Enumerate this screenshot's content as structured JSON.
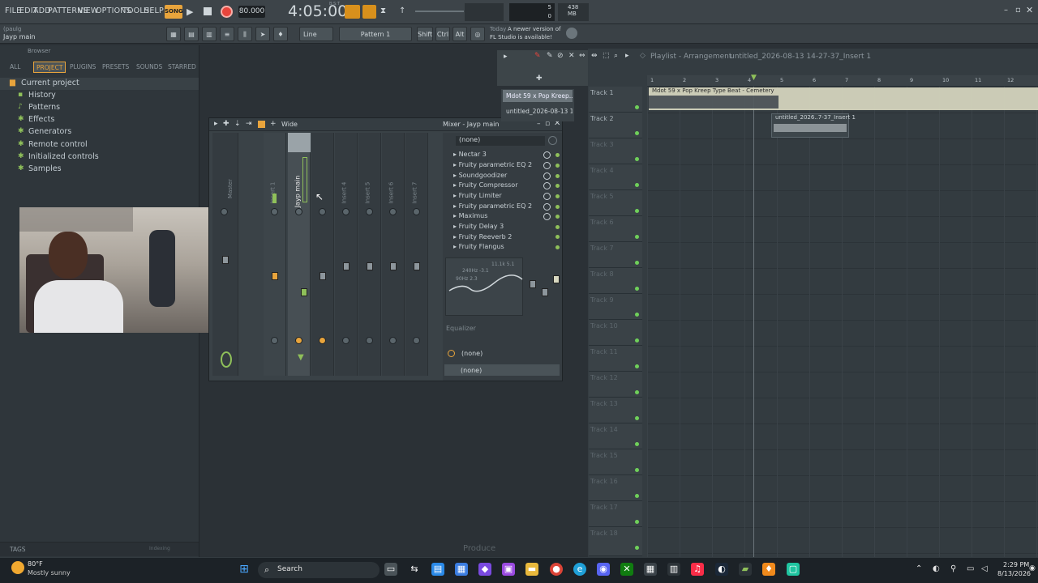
{
  "menu": [
    "FILE",
    "EDIT",
    "ADD",
    "PATTERNS",
    "VIEW",
    "OPTIONS",
    "TOOLS",
    "HELP"
  ],
  "transport": {
    "mode": "SONG",
    "tempo": "80.000",
    "time": "4:05:00",
    "time_sub": "B:S:T",
    "cpu": "5",
    "ram": "438 MB",
    "voices": "0"
  },
  "toolbar2": {
    "hint_user": "(paulg",
    "hint_channel": "Jayp main",
    "snap": "Line",
    "pattern": "Pattern 1",
    "shift": "Shift",
    "ctrl": "Ctrl",
    "alt": "Alt",
    "news_day": "Today",
    "news_line1": "A newer version of",
    "news_line2": "FL Studio is available!"
  },
  "browser": {
    "title": "Browser",
    "tabs": [
      "ALL",
      "PROJECT",
      "PLUGINS",
      "PRESETS",
      "SOUNDS",
      "STARRED"
    ],
    "items": [
      "Current project",
      "History",
      "Patterns",
      "Effects",
      "Generators",
      "Remote control",
      "Initialized controls",
      "Samples"
    ],
    "footer": "TAGS",
    "footer_right": "Indexing"
  },
  "mixer": {
    "title": "Mixer - Jayp main",
    "wide": "Wide",
    "strips": [
      "Master",
      "Insert 1",
      "Jayp main",
      "Insert 3",
      "Insert 4",
      "Insert 5",
      "Insert 6",
      "Insert 7"
    ],
    "strip_nums": [
      "C",
      "M",
      "1",
      "2",
      "3",
      "4",
      "5",
      "6",
      "7"
    ],
    "preset": "(none)",
    "fx": [
      "Nectar 3",
      "Fruity parametric EQ 2",
      "Soundgoodizer",
      "Fruity Compressor",
      "Fruity Limiter",
      "Fruity parametric EQ 2",
      "Maximus",
      "Fruity Delay 3",
      "Fruity Reeverb 2",
      "Fruity Flangus"
    ],
    "eq_label": "Equalizer",
    "eq_vals": [
      "240Hz -3.1",
      "11.1k 5.1",
      "90Hz 2.3"
    ],
    "in": "(none)",
    "out": "(none)"
  },
  "pattern_picker": [
    "Mdot 59 x Pop Kreep..",
    "untitled_2026-08-13 14..."
  ],
  "playlist": {
    "title": "Playlist - Arrangement",
    "crumb": "untitled_2026-08-13 14-27-37_Insert 1",
    "bars": [
      "1",
      "2",
      "3",
      "4",
      "5",
      "6",
      "7",
      "8",
      "9",
      "10",
      "11",
      "12"
    ],
    "clip1": "Mdot 59 x Pop Kreep Type Beat - Cemetery",
    "clip2": "untitled_2026..7-37_Insert 1",
    "tracks": [
      "Track 1",
      "Track 2",
      "Track 3",
      "Track 4",
      "Track 5",
      "Track 6",
      "Track 7",
      "Track 8",
      "Track 9",
      "Track 10",
      "Track 11",
      "Track 12",
      "Track 13",
      "Track 14",
      "Track 15",
      "Track 16",
      "Track 17",
      "Track 18"
    ]
  },
  "watermark": "Produce",
  "taskbar": {
    "weather_temp": "80°F",
    "weather_desc": "Mostly sunny",
    "search": "Search",
    "time": "2:29 PM",
    "date": "8/13/2026"
  },
  "colors": {
    "accent_green": "#8fc05a",
    "record_red": "#e8453c",
    "song_orange": "#e8a43c",
    "clip": "#d8d8c0"
  }
}
